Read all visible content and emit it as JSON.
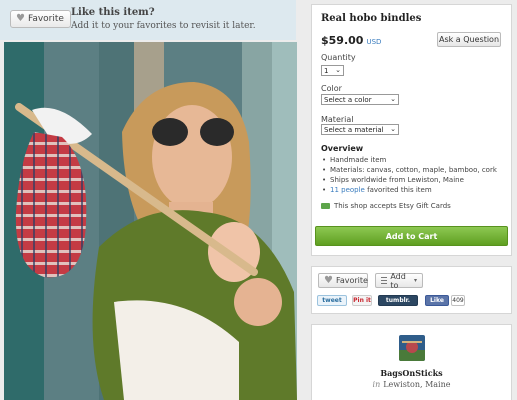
{
  "favorite_banner": {
    "button_label": "Favorite",
    "title": "Like this item?",
    "subtitle": "Add it to your favorites to revisit it later."
  },
  "listing": {
    "title": "Real hobo bindles",
    "price": "$59.00",
    "currency": "USD",
    "ask_button": "Ask a Question",
    "quantity": {
      "label": "Quantity",
      "value": "1"
    },
    "color": {
      "label": "Color",
      "value": "Select a color"
    },
    "material": {
      "label": "Material",
      "value": "Select a material"
    },
    "overview": {
      "title": "Overview",
      "items": [
        "Handmade item",
        "Materials: canvas, cotton, maple, bamboo, cork",
        "Ships worldwide from Lewiston, Maine"
      ],
      "favorited_link": "11 people",
      "favorited_suffix": "favorited this item"
    },
    "gift_card_text": "This shop accepts Etsy Gift Cards",
    "add_to_cart": "Add to Cart"
  },
  "actions": {
    "favorite": "Favorite",
    "add_to": "Add to",
    "tweet": "tweet",
    "pinit": "Pin it",
    "tumblr": "tumblr.",
    "fb_like": "Like",
    "fb_count": "409"
  },
  "shop": {
    "name": "BagsOnSticks",
    "location_prefix": "in",
    "location": "Lewiston, Maine"
  },
  "icons": [
    "heart-icon",
    "dropdown-arrow-icon",
    "gift-card-icon",
    "list-icon",
    "shop-avatar"
  ],
  "colors": {
    "banner_bg": "#dde9ef",
    "link": "#3b7dbf",
    "cart_green": "#6aad2b"
  }
}
